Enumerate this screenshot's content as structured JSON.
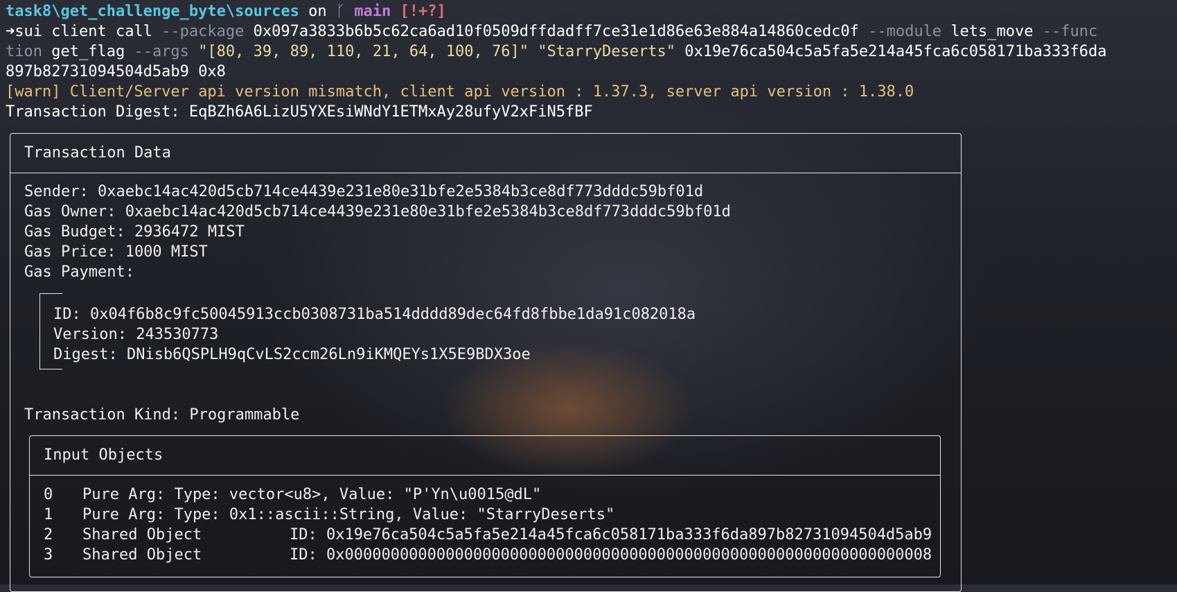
{
  "prompt": {
    "path": "task8\\get_challenge_byte\\sources",
    "on": "on",
    "branch_icon": "git-branch-icon",
    "branch": "main",
    "status": "[!+?]"
  },
  "command": {
    "arrow": "➜",
    "l1_cmd": "sui client call",
    "l1_flag1": "--package",
    "l1_pkg": "0x097a3833b6b5c62ca6ad10f0509dffdadff7ce31e1d86e63e884a14860cedc0f",
    "l1_flag2": "--module",
    "l1_module": "lets_move",
    "l1_flag3": "--func",
    "l2_flag3b": "tion",
    "l2_func": "get_flag",
    "l2_flag4": "--args",
    "l2_arg1": "\"[80, 39, 89, 110, 21, 64, 100, 76]\"",
    "l2_arg2": "\"StarryDeserts\"",
    "l2_arg3a": "0x19e76ca504c5a5fa5e214a45fca6c058171ba333f6da",
    "l3_arg3b": "897b82731094504d5ab9",
    "l3_arg4": "0x8"
  },
  "warn": "[warn] Client/Server api version mismatch, client api version : 1.37.3, server api version : 1.38.0",
  "digest_line": "Transaction Digest: EqBZh6A6LizU5YXEsiWNdY1ETMxAy28ufyV2xFiN5fBF",
  "tx": {
    "title": "Transaction Data",
    "sender": "Sender: 0xaebc14ac420d5cb714ce4439e231e80e31bfe2e5384b3ce8df773dddc59bf01d",
    "gas_owner": "Gas Owner: 0xaebc14ac420d5cb714ce4439e231e80e31bfe2e5384b3ce8df773dddc59bf01d",
    "gas_budget": "Gas Budget: 2936472 MIST",
    "gas_price": "Gas Price: 1000 MIST",
    "gas_payment": "Gas Payment:",
    "pay_id": "ID: 0x04f6b8c9fc50045913ccb0308731ba514dddd89dec64fd8fbbe1da91c082018a",
    "pay_version": "Version: 243530773",
    "pay_digest": "Digest: DNisb6QSPLH9qCvLS2ccm26Ln9iKMQEYs1X5E9BDX3oe",
    "kind": "Transaction Kind: Programmable"
  },
  "inputs": {
    "title": "Input Objects",
    "rows": [
      {
        "idx": "0",
        "kind": "Pure Arg: Type: vector<u8>, Value: \"P'Yn\\u0015@dL\"",
        "id": ""
      },
      {
        "idx": "1",
        "kind": "Pure Arg: Type: 0x1::ascii::String, Value: \"StarryDeserts\"",
        "id": ""
      },
      {
        "idx": "2",
        "kind": "Shared Object",
        "id": "ID: 0x19e76ca504c5a5fa5e214a45fca6c058171ba333f6da897b82731094504d5ab9"
      },
      {
        "idx": "3",
        "kind": "Shared Object",
        "id": "ID: 0x0000000000000000000000000000000000000000000000000000000000000008"
      }
    ]
  }
}
